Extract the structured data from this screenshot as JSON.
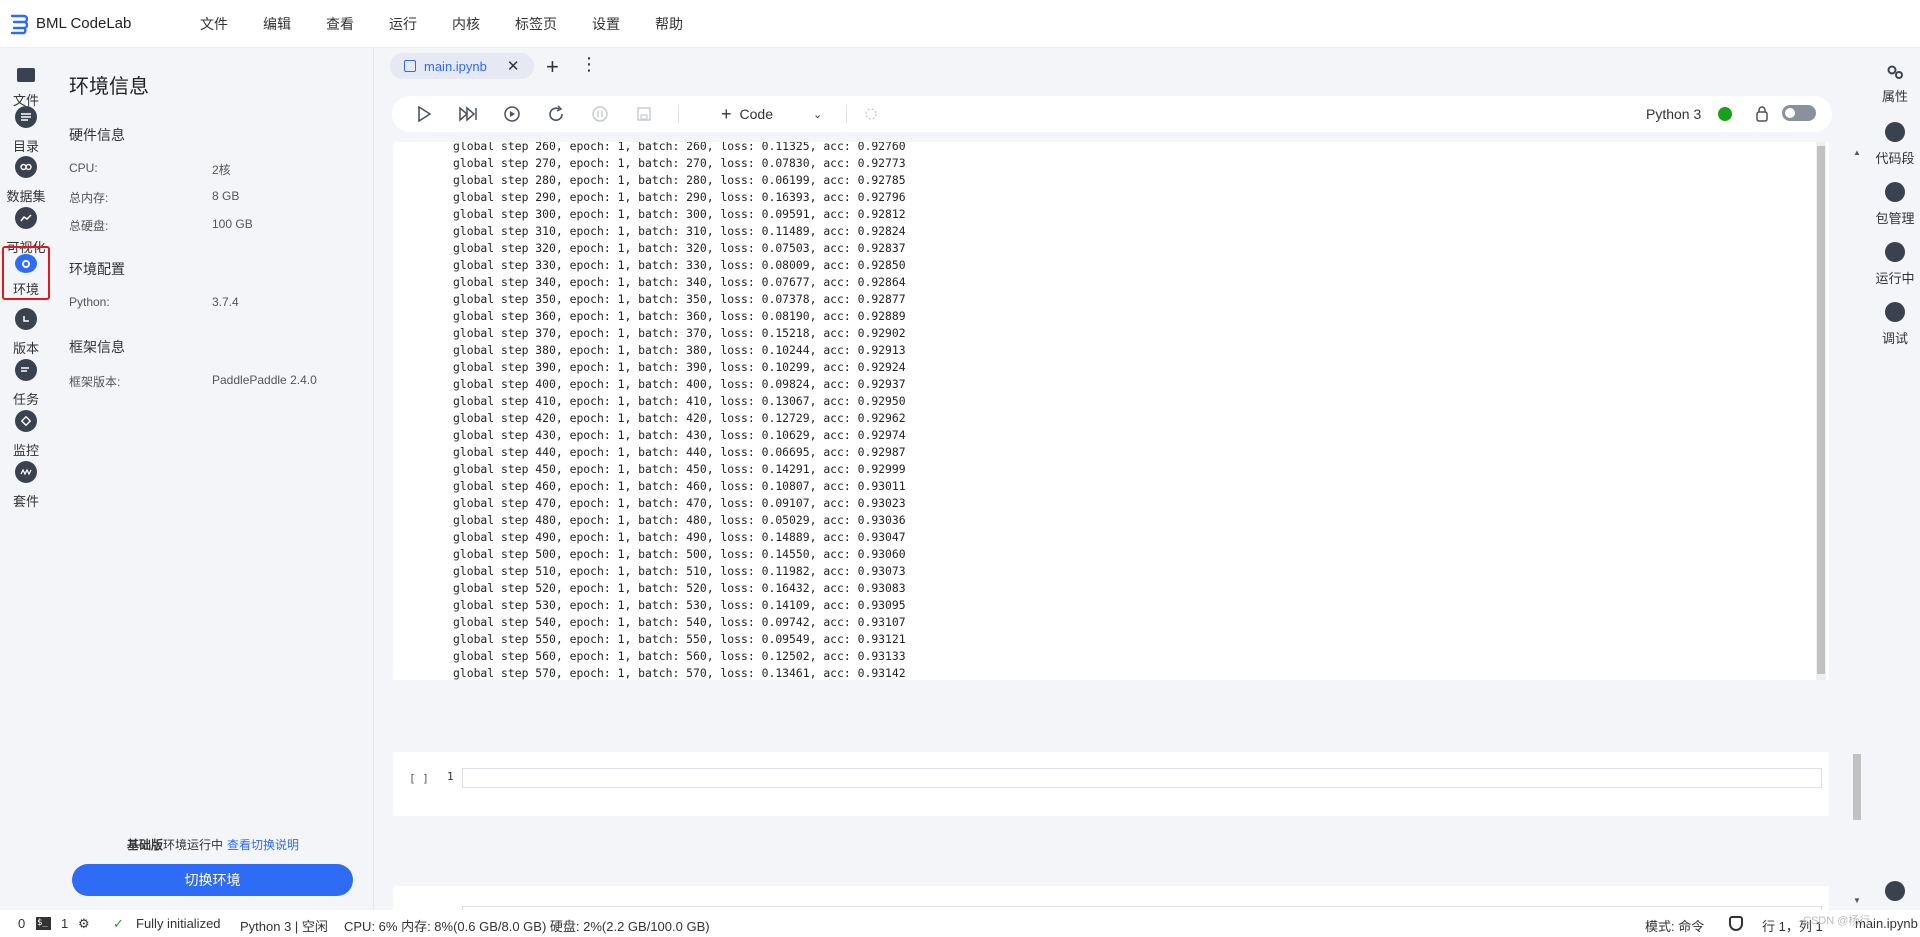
{
  "app": {
    "name": "BML CodeLab"
  },
  "menu": [
    "文件",
    "编辑",
    "查看",
    "运行",
    "内核",
    "标签页",
    "设置",
    "帮助"
  ],
  "left_rail": [
    {
      "label": "文件",
      "icon": "folder-icon"
    },
    {
      "label": "目录",
      "icon": "list-icon"
    },
    {
      "label": "数据集",
      "icon": "dataset-icon"
    },
    {
      "label": "可视化",
      "icon": "chart-icon"
    },
    {
      "label": "环境",
      "icon": "environment-icon",
      "active": true
    },
    {
      "label": "版本",
      "icon": "version-icon"
    },
    {
      "label": "任务",
      "icon": "task-icon"
    },
    {
      "label": "监控",
      "icon": "monitor-icon"
    },
    {
      "label": "套件",
      "icon": "suite-icon"
    }
  ],
  "env": {
    "title": "环境信息",
    "hardware_title": "硬件信息",
    "cpu_label": "CPU:",
    "cpu_value": "2核",
    "mem_label": "总内存:",
    "mem_value": "8 GB",
    "disk_label": "总硬盘:",
    "disk_value": "100 GB",
    "config_title": "环境配置",
    "python_label": "Python:",
    "python_value": "3.7.4",
    "framework_title": "框架信息",
    "fw_label": "框架版本:",
    "fw_value": "PaddlePaddle 2.4.0",
    "note_bold": "基础版",
    "note_text": "环境运行中",
    "note_link": "查看切换说明",
    "switch_button": "切换环境"
  },
  "tabs": {
    "main_tab": "main.ipynb",
    "add": "+",
    "more": "⋮"
  },
  "toolbar": {
    "cell_type": "Code",
    "kernel": "Python 3",
    "kernel_status_color": "#1aa01a"
  },
  "output_lines": [
    "global step 260, epoch: 1, batch: 260, loss: 0.11325, acc: 0.92760",
    "global step 270, epoch: 1, batch: 270, loss: 0.07830, acc: 0.92773",
    "global step 280, epoch: 1, batch: 280, loss: 0.06199, acc: 0.92785",
    "global step 290, epoch: 1, batch: 290, loss: 0.16393, acc: 0.92796",
    "global step 300, epoch: 1, batch: 300, loss: 0.09591, acc: 0.92812",
    "global step 310, epoch: 1, batch: 310, loss: 0.11489, acc: 0.92824",
    "global step 320, epoch: 1, batch: 320, loss: 0.07503, acc: 0.92837",
    "global step 330, epoch: 1, batch: 330, loss: 0.08009, acc: 0.92850",
    "global step 340, epoch: 1, batch: 340, loss: 0.07677, acc: 0.92864",
    "global step 350, epoch: 1, batch: 350, loss: 0.07378, acc: 0.92877",
    "global step 360, epoch: 1, batch: 360, loss: 0.08190, acc: 0.92889",
    "global step 370, epoch: 1, batch: 370, loss: 0.15218, acc: 0.92902",
    "global step 380, epoch: 1, batch: 380, loss: 0.10244, acc: 0.92913",
    "global step 390, epoch: 1, batch: 390, loss: 0.10299, acc: 0.92924",
    "global step 400, epoch: 1, batch: 400, loss: 0.09824, acc: 0.92937",
    "global step 410, epoch: 1, batch: 410, loss: 0.13067, acc: 0.92950",
    "global step 420, epoch: 1, batch: 420, loss: 0.12729, acc: 0.92962",
    "global step 430, epoch: 1, batch: 430, loss: 0.10629, acc: 0.92974",
    "global step 440, epoch: 1, batch: 440, loss: 0.06695, acc: 0.92987",
    "global step 450, epoch: 1, batch: 450, loss: 0.14291, acc: 0.92999",
    "global step 460, epoch: 1, batch: 460, loss: 0.10807, acc: 0.93011",
    "global step 470, epoch: 1, batch: 470, loss: 0.09107, acc: 0.93023",
    "global step 480, epoch: 1, batch: 480, loss: 0.05029, acc: 0.93036",
    "global step 490, epoch: 1, batch: 490, loss: 0.14889, acc: 0.93047",
    "global step 500, epoch: 1, batch: 500, loss: 0.14550, acc: 0.93060",
    "global step 510, epoch: 1, batch: 510, loss: 0.11982, acc: 0.93073",
    "global step 520, epoch: 1, batch: 520, loss: 0.16432, acc: 0.93083",
    "global step 530, epoch: 1, batch: 530, loss: 0.14109, acc: 0.93095",
    "global step 540, epoch: 1, batch: 540, loss: 0.09742, acc: 0.93107",
    "global step 550, epoch: 1, batch: 550, loss: 0.09549, acc: 0.93121",
    "global step 560, epoch: 1, batch: 560, loss: 0.12502, acc: 0.93133",
    "global step 570, epoch: 1, batch: 570, loss: 0.13461, acc: 0.93142"
  ],
  "cell2": {
    "prompt": "[ ]",
    "line_number": "1"
  },
  "right_rail": [
    {
      "label": "属性",
      "icon": "gears-icon"
    },
    {
      "label": "代码段",
      "icon": "code-snippet-icon"
    },
    {
      "label": "包管理",
      "icon": "package-icon"
    },
    {
      "label": "运行中",
      "icon": "running-icon"
    },
    {
      "label": "调试",
      "icon": "debug-icon"
    }
  ],
  "status": {
    "count_a": "0",
    "count_b": "1",
    "init_text": "Fully initialized",
    "kernel_state": "Python 3 | 空闲",
    "resources": "CPU:  6% 内存:  8%(0.6 GB/8.0 GB) 硬盘:  2%(2.2 GB/100.0 GB)",
    "mode": "模式: 命令",
    "position": "行 1，列 1",
    "file": "main.ipynb",
    "watermark": "CSDN @杨行"
  }
}
